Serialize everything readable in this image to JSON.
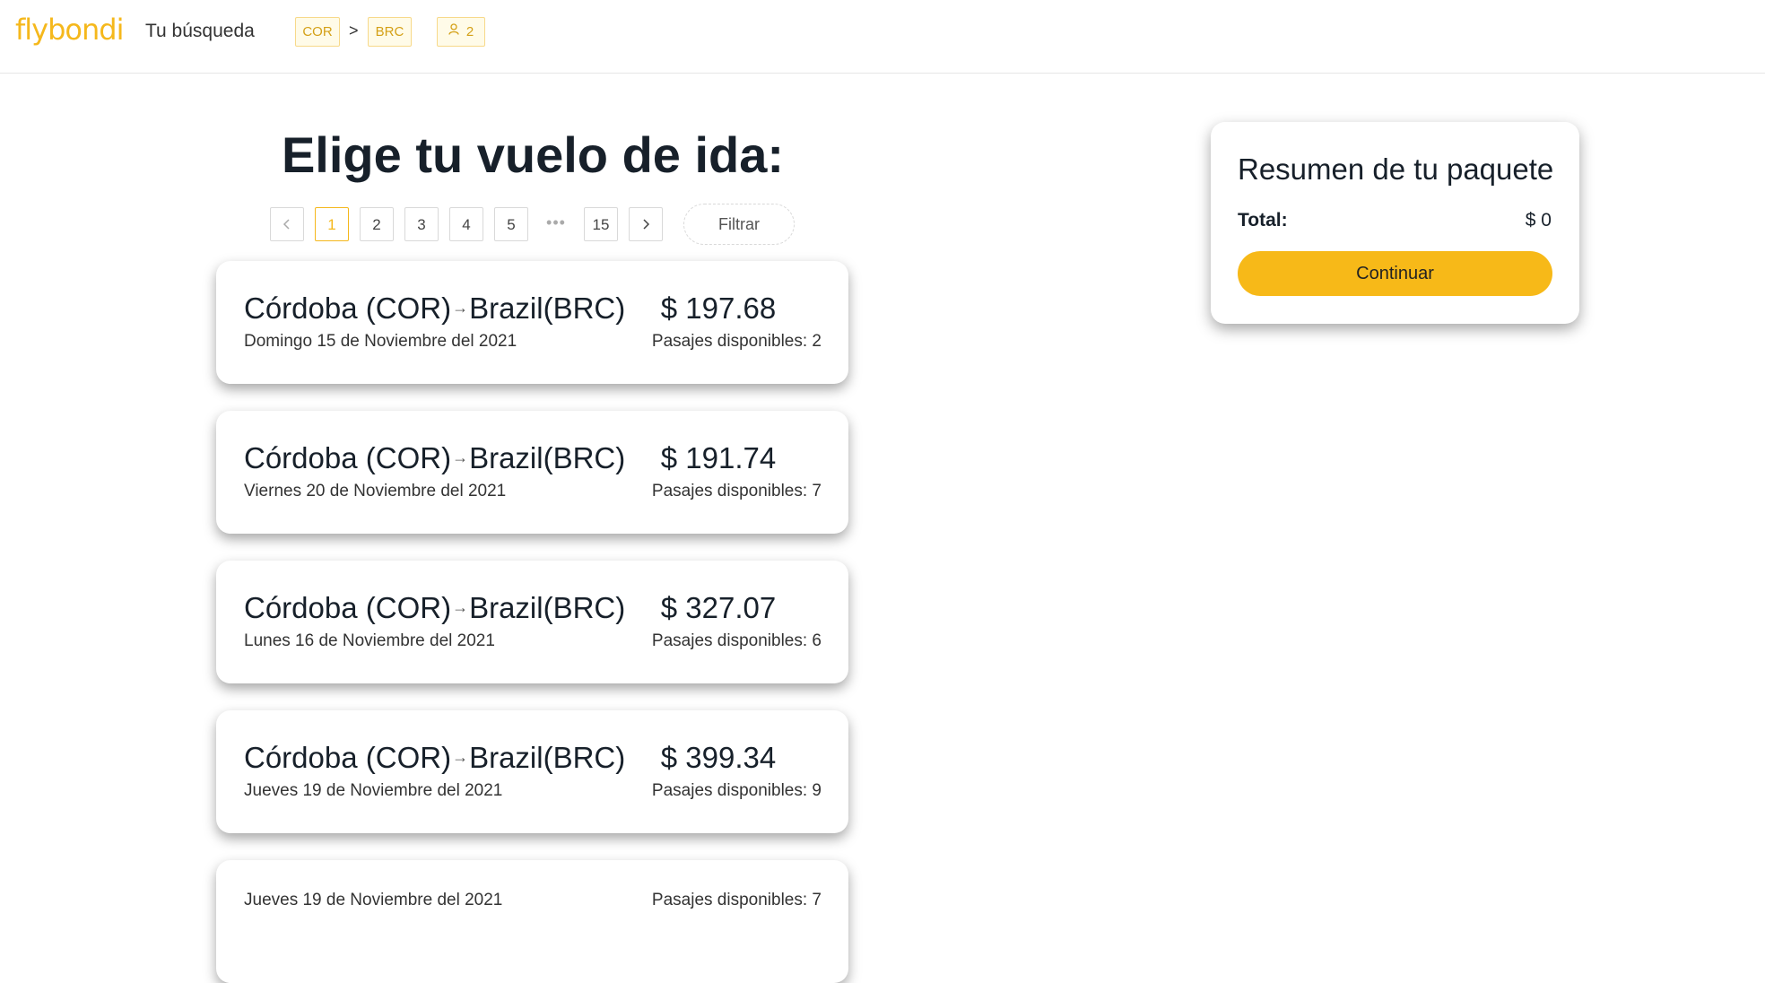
{
  "header": {
    "logo": "flybondi",
    "search_label": "Tu búsqueda",
    "origin_code": "COR",
    "route_separator": ">",
    "destination_code": "BRC",
    "passengers": "2",
    "passenger_icon": "user-icon"
  },
  "main": {
    "title": "Elige tu vuelo de ida:",
    "pagination": {
      "prev_icon": "chevron-left-icon",
      "next_icon": "chevron-right-icon",
      "pages": [
        "1",
        "2",
        "3",
        "4",
        "5"
      ],
      "ellipsis": "•••",
      "last_page": "15",
      "current_page": "1",
      "prev": "<",
      "next": ">"
    },
    "filter_label": "Filtrar",
    "flights": [
      {
        "origin": "Córdoba (COR)",
        "destination": "Brazil(BRC)",
        "date": "Domingo 15 de Noviembre del 2021",
        "price": "$ 197.68",
        "seats": "Pasajes disponibles: 2"
      },
      {
        "origin": "Córdoba (COR)",
        "destination": "Brazil(BRC)",
        "date": "Viernes 20 de Noviembre del 2021",
        "price": "$ 191.74",
        "seats": "Pasajes disponibles: 7"
      },
      {
        "origin": "Córdoba (COR)",
        "destination": "Brazil(BRC)",
        "date": "Lunes 16 de Noviembre del 2021",
        "price": "$ 327.07",
        "seats": "Pasajes disponibles: 6"
      },
      {
        "origin": "Córdoba (COR)",
        "destination": "Brazil(BRC)",
        "date": "Jueves 19 de Noviembre del 2021",
        "price": "$ 399.34",
        "seats": "Pasajes disponibles: 9"
      },
      {
        "origin": "",
        "destination": "",
        "date": "Jueves 19 de Noviembre del 2021",
        "price": "",
        "seats": "Pasajes disponibles: 7"
      }
    ]
  },
  "summary": {
    "title": "Resumen de tu paquete",
    "total_label": "Total:",
    "total_value": "$ 0",
    "continue_label": "Continuar"
  },
  "colors": {
    "accent": "#f7b918",
    "text": "#17202a"
  }
}
